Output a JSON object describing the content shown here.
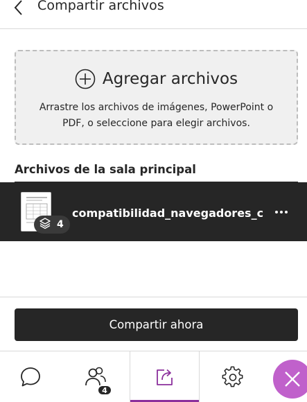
{
  "header": {
    "title": "Compartir archivos",
    "back_icon": "chevron-left-icon"
  },
  "dropzone": {
    "title": "Agregar archivos",
    "description": "Arrastre los archivos de imágenes, PowerPoint o PDF, o seleccione para elegir archivos.",
    "icon": "plus-circle-icon"
  },
  "section": {
    "title": "Archivos de la sala principal"
  },
  "files": [
    {
      "name": "compatibilidad_navegadores_c...",
      "page_count": "4",
      "icons": [
        "document-thumbnail",
        "layers-icon",
        "more-horizontal-icon"
      ]
    }
  ],
  "share_button": {
    "label": "Compartir ahora"
  },
  "tabbar": {
    "tabs": [
      {
        "id": "chat",
        "icon": "chat-icon"
      },
      {
        "id": "participants",
        "icon": "participants-icon",
        "badge": "4"
      },
      {
        "id": "share",
        "icon": "share-content-icon",
        "active": true
      },
      {
        "id": "settings",
        "icon": "gear-icon"
      }
    ],
    "close_icon": "close-icon"
  },
  "colors": {
    "text": "#262626",
    "dark": "#262626",
    "accent": "#8b2f9c",
    "close_fab": "#c061cb",
    "dropzone_bg": "#f0f0f0"
  }
}
